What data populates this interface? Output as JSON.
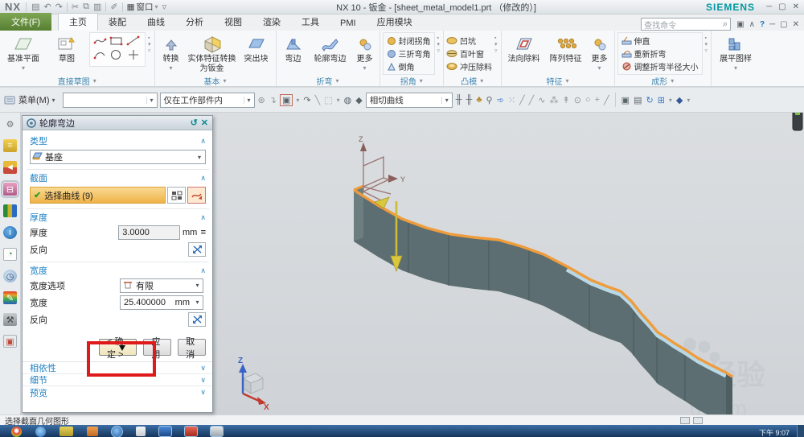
{
  "window": {
    "logo": "NX",
    "title": "NX 10 - 钣金 - [sheet_metal_model1.prt （修改的）]",
    "brand": "SIEMENS",
    "menu_window": "窗口"
  },
  "icons": {
    "save": "▤",
    "undo": "↶",
    "redo": "↷",
    "cut": "✂",
    "copy": "⧉",
    "paste": "▥",
    "brush": "✐",
    "screen": "▦",
    "caret": "▾",
    "overflow": "▿",
    "search": "⌕",
    "fullscreen": "▣",
    "ribbon_min": "∧",
    "help": "?",
    "minimize": "─",
    "restore": "▢",
    "close": "✕",
    "reset": "↺",
    "chevron_up": "∧",
    "chevron_down": "∨",
    "check": "✔",
    "equals": "=",
    "pen": "✎",
    "grid": "⊞"
  },
  "tabs": [
    {
      "label": "文件(F)"
    },
    {
      "label": "主页"
    },
    {
      "label": "装配"
    },
    {
      "label": "曲线"
    },
    {
      "label": "分析"
    },
    {
      "label": "视图"
    },
    {
      "label": "渲染"
    },
    {
      "label": "工具"
    },
    {
      "label": "PMI"
    },
    {
      "label": "应用模块"
    }
  ],
  "find": {
    "placeholder": "查找命令"
  },
  "ribbon": {
    "datum_plane": "基准平面",
    "sketch": "草图",
    "direct_sketch": "直接草图",
    "basic": {
      "label": "基本",
      "convert": "转换",
      "solid_to_sheet": "实体特征转换为钣金",
      "tab": "突出块"
    },
    "bend": {
      "label": "折弯",
      "flange": "弯边",
      "contour_flange": "轮廓弯边",
      "more": "更多"
    },
    "corner": {
      "label": "拐角",
      "closed_corner": "封闭拐角",
      "three_bend_corner": "三折弯角",
      "chamfer": "倒角"
    },
    "punch": {
      "label": "凸模",
      "dimple": "凹坑",
      "louver": "百叶窗",
      "solid_punch": "冲压除料"
    },
    "feature": {
      "label": "特征",
      "normal_cutout": "法向除料",
      "pattern": "阵列特征",
      "more": "更多"
    },
    "form": {
      "label": "成形",
      "unbend": "伸直",
      "rebend": "重新折弯",
      "resize_radius": "调整折弯半径大小"
    },
    "flat_pattern": "展平图样"
  },
  "toolbar": {
    "menu": "菜单(M)",
    "scope": "仅在工作部件内",
    "curve_rule": "相切曲线"
  },
  "dialog": {
    "title": "轮廓弯边",
    "type": {
      "header": "类型",
      "value": "基座"
    },
    "section": {
      "header": "截面",
      "select": "选择曲线 (9)"
    },
    "thickness": {
      "header": "厚度",
      "label": "厚度",
      "value": "3.0000",
      "unit": "mm",
      "reverse": "反向"
    },
    "width": {
      "header": "宽度",
      "option_label": "宽度选项",
      "option_value": "有限",
      "label": "宽度",
      "value": "25.400000",
      "unit": "mm",
      "reverse": "反向"
    },
    "buttons": {
      "ok": "< 确定 >",
      "apply": "应用",
      "cancel": "取消"
    },
    "collapsed": [
      {
        "label": "相依性"
      },
      {
        "label": "细节"
      },
      {
        "label": "预览"
      }
    ]
  },
  "viewport": {
    "csys": {
      "z": "Z",
      "y": "Y"
    },
    "triad": {
      "z": "Z",
      "x": "X"
    },
    "watermark": {
      "paw": "du",
      "main": "经验",
      "tail": "u.com"
    }
  },
  "status": {
    "message": "选择截面几何图形"
  },
  "taskbar": {
    "clock": "下午 9:07"
  }
}
